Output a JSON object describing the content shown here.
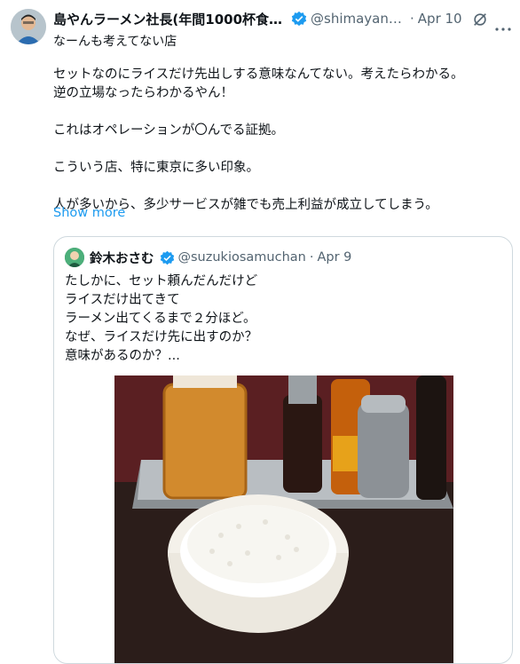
{
  "post": {
    "author_name": "島やんラーメン社長(年間1000杯食べ…",
    "author_handle": "@shimayanra…",
    "date": "Apr 10",
    "subtitle": "なーんも考えてない店",
    "lines": [
      "セットなのにライスだけ先出しする意味なんてない。考えたらわかる。",
      "逆の立場なったらわかるやん！",
      "",
      "これはオペレーションが〇んでる証拠。",
      "",
      "こういう店、特に東京に多い印象。",
      "",
      "人が多いから、多少サービスが雑でも売上利益が成立してしまう。"
    ],
    "show_more": "Show more",
    "icons": [
      "verified-badge-icon",
      "grok-icon",
      "more-icon"
    ]
  },
  "quote": {
    "author_name": "鈴木おさむ",
    "author_handle": "@suzukiosamuchan",
    "date": "Apr 9",
    "lines": [
      "たしかに、セット頼んだんだけど",
      "ライスだけ出てきて",
      "ラーメン出てくるまで２分ほど。",
      "なぜ、ライスだけ先に出すのか？",
      "意味があるのか？..."
    ]
  },
  "colors": {
    "text": "#0f1419",
    "secondary": "#536471",
    "link": "#1d9bf0",
    "border": "#cfd9de",
    "verified": "#1d9bf0"
  }
}
